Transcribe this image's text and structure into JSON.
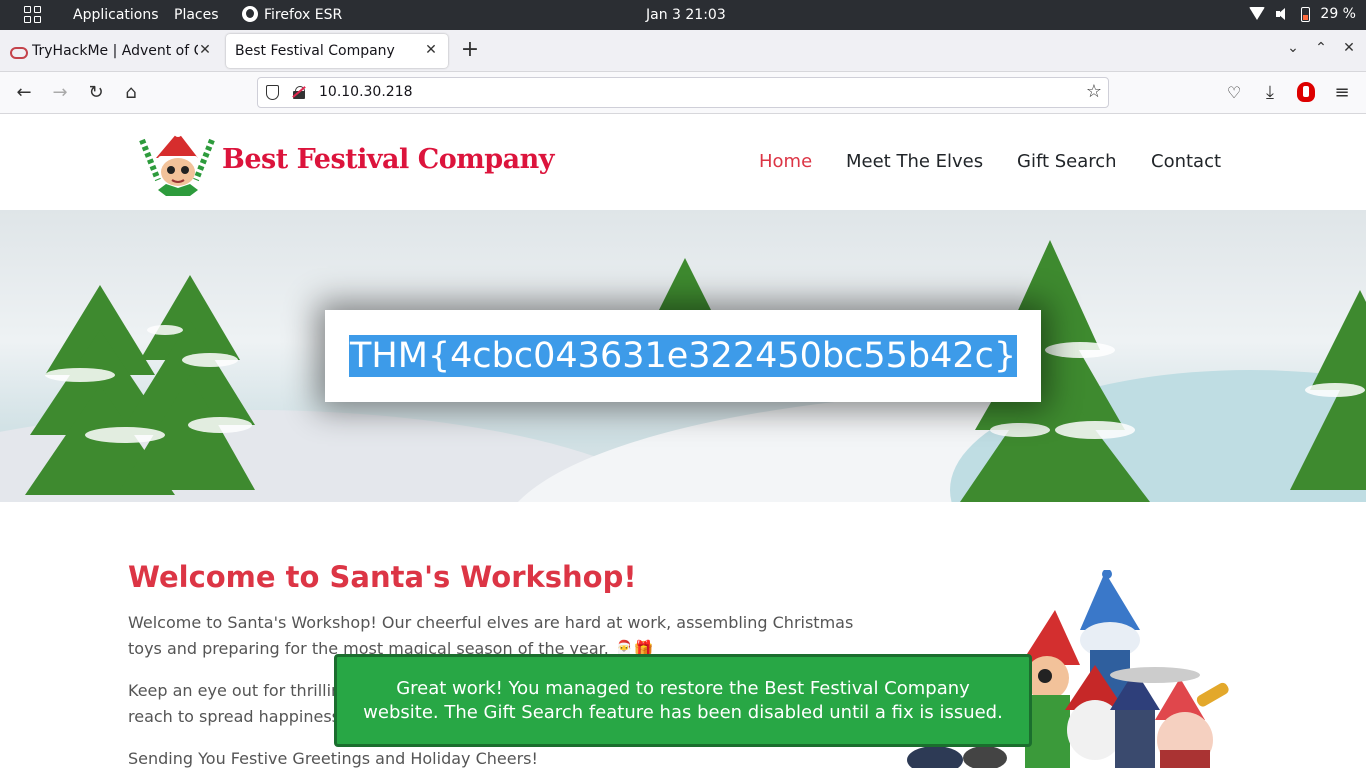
{
  "system_bar": {
    "applications": "Applications",
    "places": "Places",
    "browser_name": "Firefox ESR",
    "datetime": "Jan 3  21:03",
    "battery": "29 %"
  },
  "browser": {
    "tabs": [
      {
        "title": "TryHackMe | Advent of Cyber",
        "active": false
      },
      {
        "title": "Best Festival Company",
        "active": true
      }
    ],
    "new_tab": "+",
    "url": "10.10.30.218"
  },
  "site": {
    "brand": "Best Festival Company",
    "nav": [
      "Home",
      "Meet The Elves",
      "Gift Search",
      "Contact"
    ],
    "active_nav": "Home",
    "flag": "THM{4cbc043631e322450bc55b42c}",
    "welcome_title": "Welcome to Santa's Workshop!",
    "para1_line1": "Welcome to Santa's Workshop! Our cheerful elves are hard at work, assembling Christmas",
    "para1_line2": "toys and preparing for the most magical season of the year. 🎅🎁",
    "para2_line1": "Keep an eye out for thrilling",
    "para2_line2": "reach to spread happiness",
    "para3": "Sending You Festive Greetings and Holiday Cheers!"
  },
  "toast": {
    "line1": "Great work! You managed to restore the Best Festival Company",
    "line2": "website. The Gift Search feature has been disabled until a fix is issued."
  },
  "colors": {
    "accent_red": "#dc3545",
    "toast_green": "#28a745",
    "selection_blue": "#3d9be9"
  }
}
